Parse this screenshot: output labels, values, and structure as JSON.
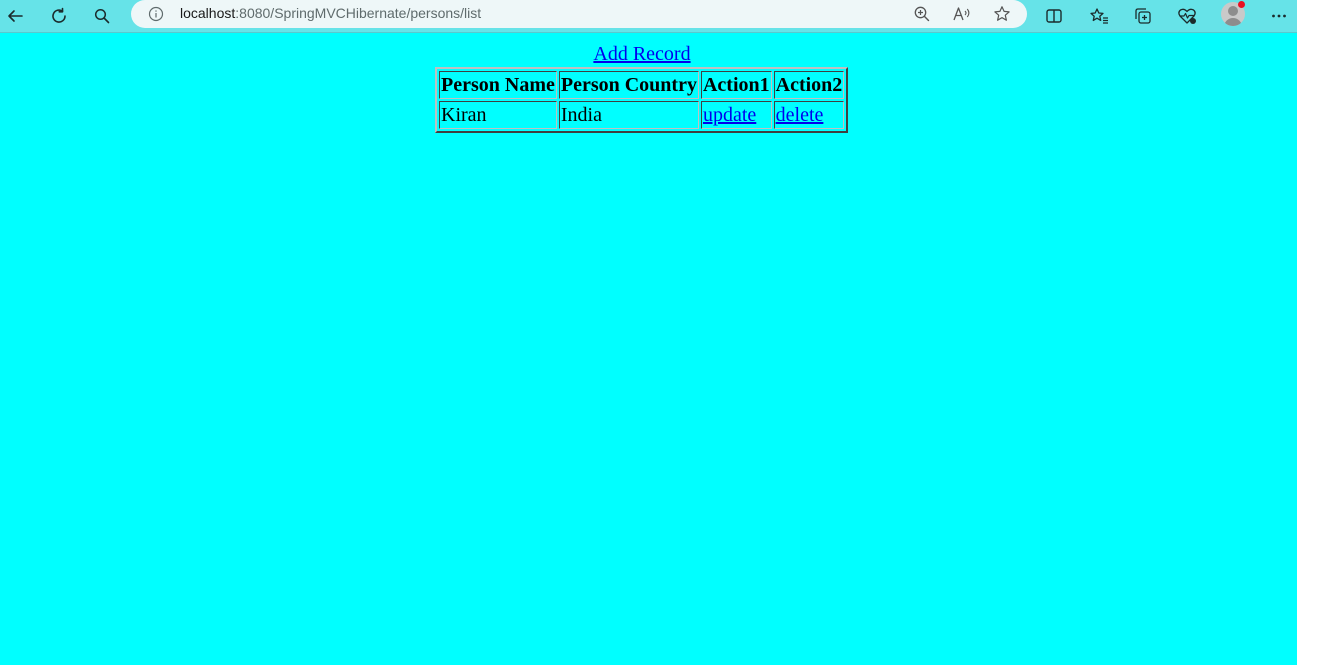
{
  "browser": {
    "url_host": "localhost",
    "url_rest": ":8080/SpringMVCHibernate/persons/list",
    "icons": {
      "back": "back-arrow-icon",
      "reload": "refresh-icon",
      "search": "search-icon",
      "site_info": "info-icon",
      "zoom": "zoom-in-icon",
      "read_aloud": "read-aloud-icon",
      "favorite": "star-icon",
      "split_screen": "split-screen-icon",
      "favorites": "favorites-icon",
      "collections": "collections-icon",
      "browser_essentials": "heart-pulse-icon",
      "profile": "avatar",
      "more": "more-icon"
    },
    "colors": {
      "toolbar": "#66e3e8",
      "page_background": "#00ffff",
      "link": "#0000ee"
    }
  },
  "page": {
    "add_record_label": "Add Record",
    "table": {
      "headers": [
        "Person Name",
        "Person Country",
        "Action1",
        "Action2"
      ],
      "rows": [
        {
          "name": "Kiran",
          "country": "India",
          "action1": "update",
          "action2": "delete"
        }
      ]
    }
  }
}
